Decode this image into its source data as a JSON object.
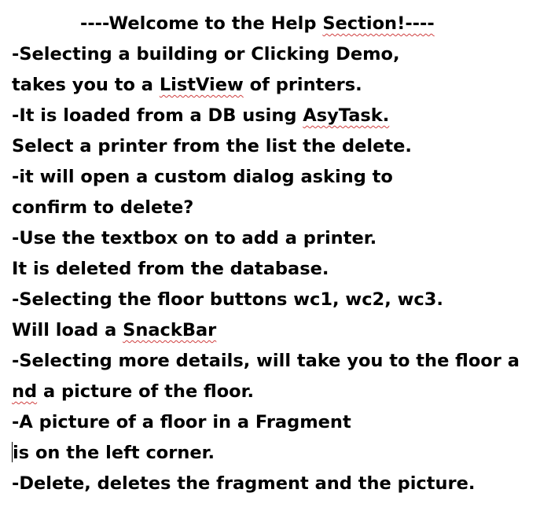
{
  "document": {
    "title": {
      "before": "----Welcome to the Help ",
      "squiggle": "Section!----",
      "after": ""
    },
    "lines": [
      {
        "before": "-Selecting a building or Clicking Demo,",
        "squiggle": "",
        "after": ""
      },
      {
        "before": "takes you to a ",
        "squiggle": "ListView",
        "after": " of printers."
      },
      {
        "before": "-It is loaded from a DB using ",
        "squiggle": "AsyTask.",
        "after": ""
      },
      {
        "before": "Select a printer from the list the delete.",
        "squiggle": "",
        "after": ""
      },
      {
        "before": "-it will open a custom dialog asking to",
        "squiggle": "",
        "after": ""
      },
      {
        "before": "confirm to delete?",
        "squiggle": "",
        "after": ""
      },
      {
        "before": "-Use the textbox on to add a printer.",
        "squiggle": "",
        "after": ""
      },
      {
        "before": "It is deleted from the database.",
        "squiggle": "",
        "after": ""
      },
      {
        "before": "-Selecting the floor buttons wc1, wc2, wc3.",
        "squiggle": "",
        "after": ""
      },
      {
        "before": "Will load a ",
        "squiggle": "SnackBar",
        "after": ""
      },
      {
        "before": "-Selecting more details, will take you to the floor a",
        "squiggle": "",
        "after": ""
      },
      {
        "before": "",
        "squiggle": "nd",
        "after": " a picture of the floor."
      },
      {
        "before": "-A picture of a floor in a Fragment",
        "squiggle": "",
        "after": ""
      },
      {
        "before": "is on the left corner.",
        "squiggle": "",
        "after": ""
      },
      {
        "before": "-Delete, deletes the fragment and the picture.",
        "squiggle": "",
        "after": ""
      }
    ]
  },
  "colors": {
    "text": "#000000",
    "background": "#ffffff",
    "spellcheck_underline": "#d04040"
  }
}
